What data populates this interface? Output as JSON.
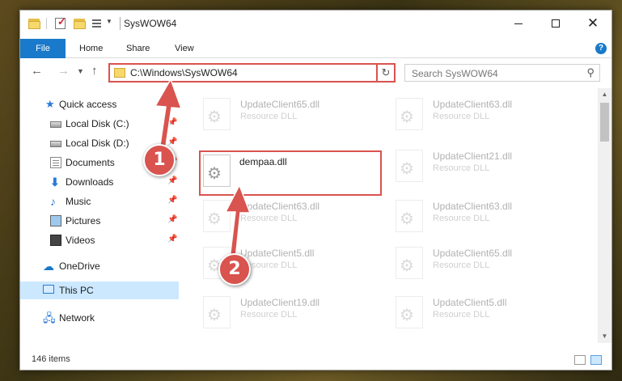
{
  "window": {
    "title": "SysWOW64"
  },
  "ribbon": {
    "tabs": [
      {
        "label": "File"
      },
      {
        "label": "Home"
      },
      {
        "label": "Share"
      },
      {
        "label": "View"
      }
    ],
    "help": "?"
  },
  "address_bar": {
    "path": "C:\\Windows\\SysWOW64"
  },
  "search": {
    "placeholder": "Search SysWOW64"
  },
  "sidebar": {
    "items": [
      {
        "label": "Quick access",
        "icon": "star-icon"
      },
      {
        "label": "Local Disk (C:)",
        "icon": "disk-icon",
        "pinned": true
      },
      {
        "label": "Local Disk (D:)",
        "icon": "disk-icon",
        "pinned": true
      },
      {
        "label": "Documents",
        "icon": "documents-icon",
        "pinned": true
      },
      {
        "label": "Downloads",
        "icon": "download-icon",
        "pinned": true
      },
      {
        "label": "Music",
        "icon": "music-icon",
        "pinned": true
      },
      {
        "label": "Pictures",
        "icon": "pictures-icon",
        "pinned": true
      },
      {
        "label": "Videos",
        "icon": "videos-icon",
        "pinned": true
      },
      {
        "label": "OneDrive",
        "icon": "onedrive-icon"
      },
      {
        "label": "This PC",
        "icon": "this-pc-icon",
        "selected": true
      },
      {
        "label": "Network",
        "icon": "network-icon"
      }
    ]
  },
  "files": [
    {
      "name": "UpdateClient65.dll",
      "type": "Resource DLL"
    },
    {
      "name": "UpdateClient63.dll",
      "type": "Resource DLL"
    },
    {
      "name": "dempaa.dll",
      "type": ""
    },
    {
      "name": "UpdateClient21.dll",
      "type": "Resource DLL"
    },
    {
      "name": "UpdateClient63.dll",
      "type": "Resource DLL"
    },
    {
      "name": "UpdateClient63.dll",
      "type": "Resource DLL"
    },
    {
      "name": "UpdateClient5.dll",
      "type": "Resource DLL"
    },
    {
      "name": "UpdateClient65.dll",
      "type": "Resource DLL"
    },
    {
      "name": "UpdateClient19.dll",
      "type": "Resource DLL"
    },
    {
      "name": "UpdateClient5.dll",
      "type": "Resource DLL"
    }
  ],
  "status": {
    "item_count": "146 items"
  },
  "annotations": {
    "step1": "1",
    "step2": "2",
    "highlight_color": "#d9534f"
  }
}
